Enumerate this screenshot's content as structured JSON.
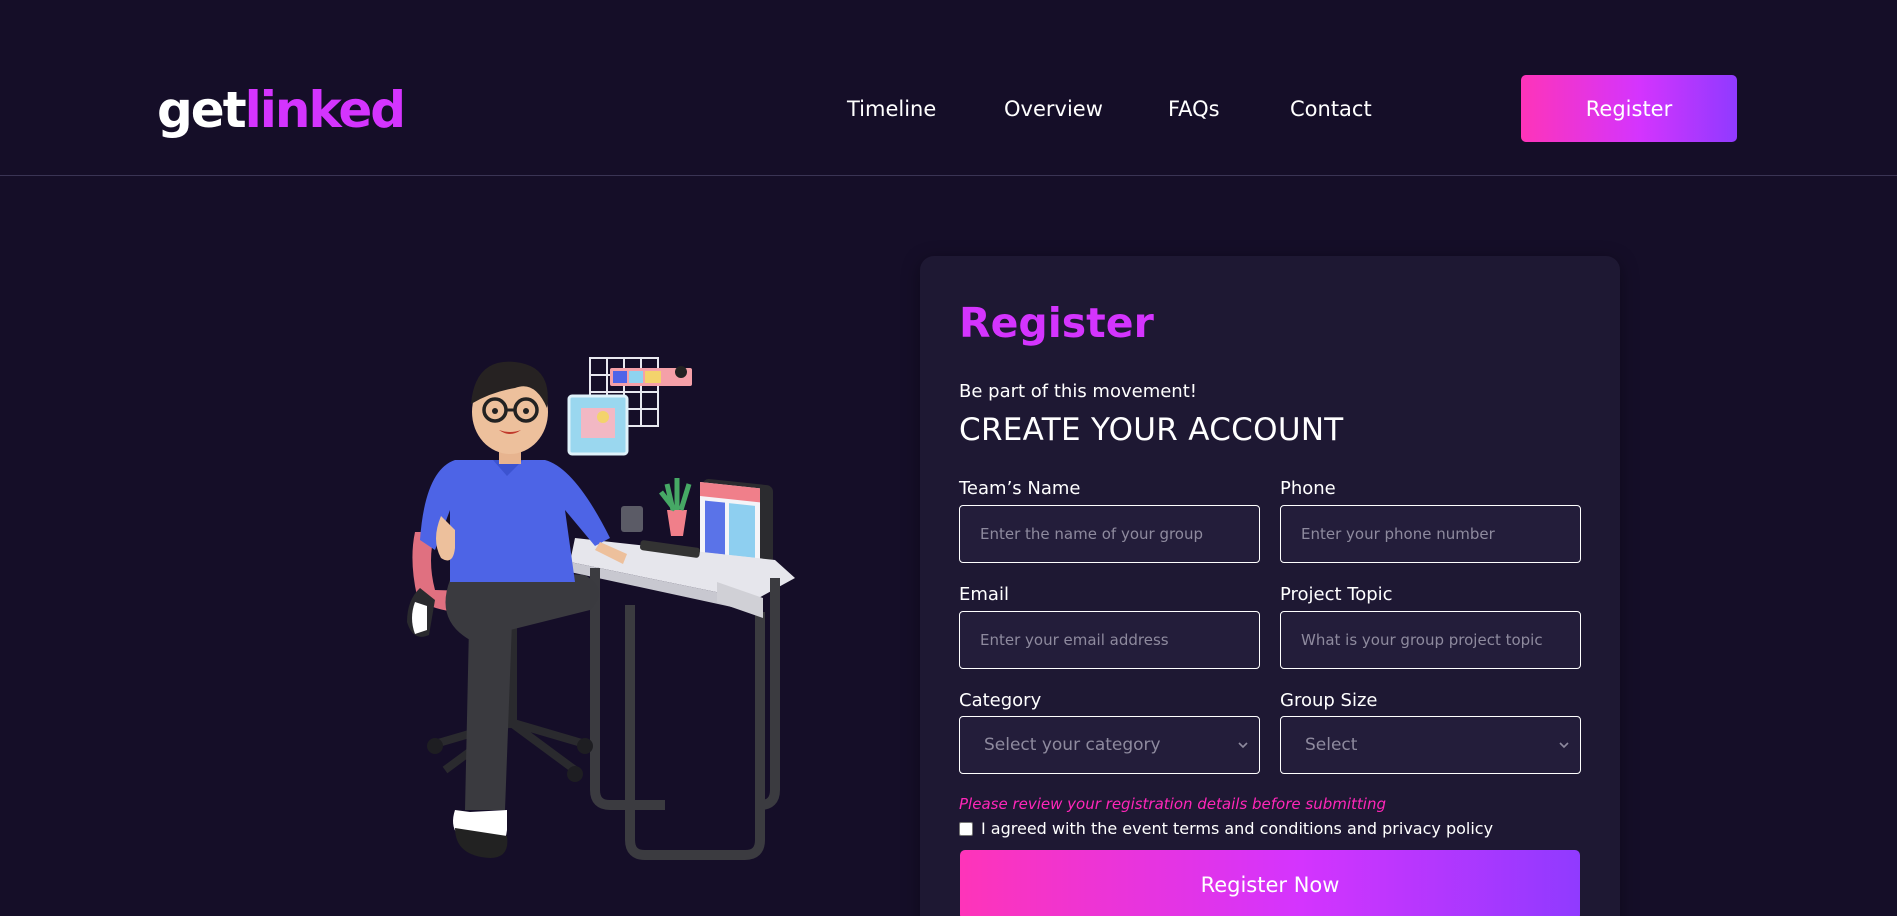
{
  "header": {
    "logo_part1": "get",
    "logo_part2": "linked",
    "nav": [
      "Timeline",
      "Overview",
      "FAQs",
      "Contact"
    ],
    "register_label": "Register"
  },
  "form": {
    "title": "Register",
    "subtitle": "Be part of this movement!",
    "heading": "CREATE YOUR ACCOUNT",
    "team_name": {
      "label": "Team’s Name",
      "placeholder": "Enter the name of your group",
      "value": ""
    },
    "phone": {
      "label": "Phone",
      "placeholder": "Enter your phone number",
      "value": ""
    },
    "email": {
      "label": "Email",
      "placeholder": "Enter your email address",
      "value": ""
    },
    "project_topic": {
      "label": "Project Topic",
      "placeholder": "What is your group project topic",
      "value": ""
    },
    "category": {
      "label": "Category",
      "selected": "Select your category"
    },
    "group_size": {
      "label": "Group Size",
      "selected": "Select"
    },
    "warning": "Please review your registration details before submitting",
    "agree_text": "I agreed with the event terms and conditions and privacy policy",
    "agree_checked": false,
    "submit_label": "Register Now"
  },
  "colors": {
    "background": "#150e28",
    "card": "#1e1833",
    "accent": "#d434fe",
    "gradient_start": "#fe34b9",
    "gradient_end": "#903aff",
    "warning": "#ff26b9"
  }
}
